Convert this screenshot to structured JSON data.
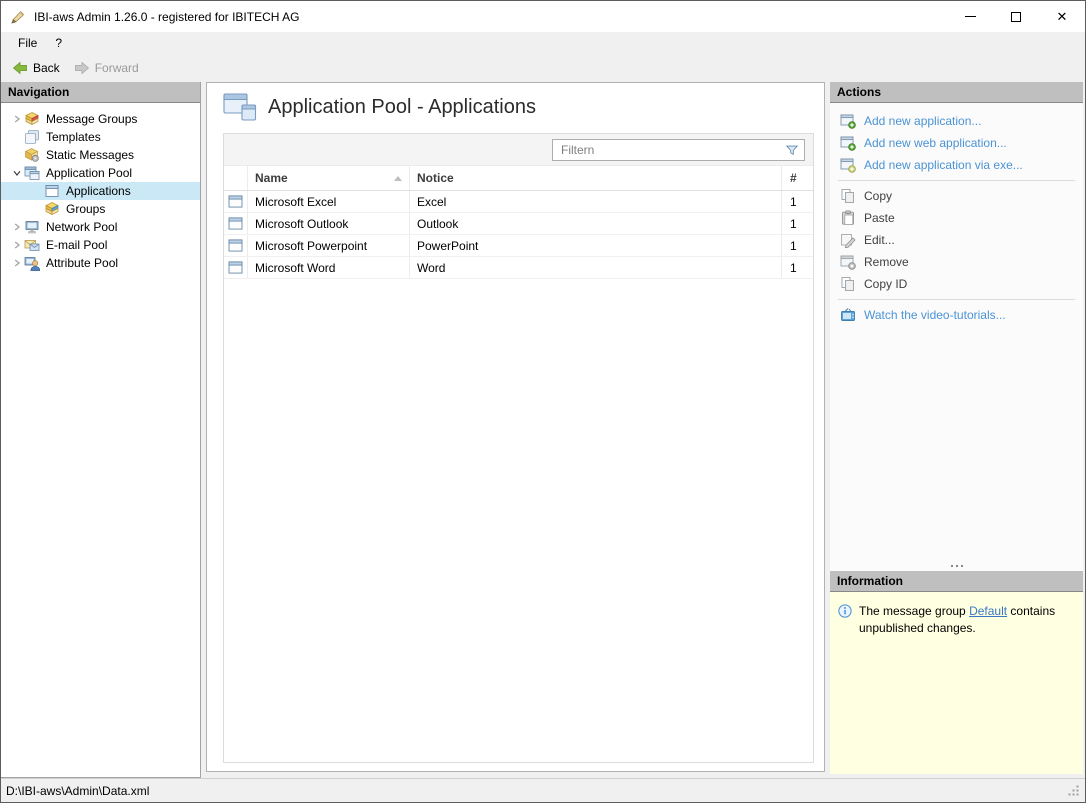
{
  "window": {
    "title": "IBI-aws Admin 1.26.0 - registered for IBITECH AG",
    "controls": {
      "close": "✕"
    }
  },
  "menu": {
    "items": [
      {
        "label": "File"
      },
      {
        "label": "?"
      }
    ]
  },
  "toolbar": {
    "back_label": "Back",
    "forward_label": "Forward"
  },
  "navigation": {
    "header": "Navigation",
    "items": [
      {
        "label": "Message Groups",
        "icon": "message-groups-icon",
        "expander": "collapsed",
        "level": 0,
        "selected": false
      },
      {
        "label": "Templates",
        "icon": "templates-icon",
        "expander": "none",
        "level": 0,
        "selected": false
      },
      {
        "label": "Static Messages",
        "icon": "static-messages-icon",
        "expander": "none",
        "level": 0,
        "selected": false
      },
      {
        "label": "Application Pool",
        "icon": "application-pool-icon",
        "expander": "expanded",
        "level": 0,
        "selected": false
      },
      {
        "label": "Applications",
        "icon": "applications-icon",
        "expander": "none",
        "level": 1,
        "selected": true
      },
      {
        "label": "Groups",
        "icon": "groups-icon",
        "expander": "none",
        "level": 1,
        "selected": false
      },
      {
        "label": "Network Pool",
        "icon": "network-pool-icon",
        "expander": "collapsed",
        "level": 0,
        "selected": false
      },
      {
        "label": "E-mail Pool",
        "icon": "email-pool-icon",
        "expander": "collapsed",
        "level": 0,
        "selected": false
      },
      {
        "label": "Attribute Pool",
        "icon": "attribute-pool-icon",
        "expander": "collapsed",
        "level": 0,
        "selected": false
      }
    ]
  },
  "main": {
    "title": "Application Pool - Applications",
    "filter": {
      "placeholder": "Filtern"
    },
    "table": {
      "columns": [
        "Name",
        "Notice",
        "#"
      ],
      "sort": {
        "column": "Name",
        "direction": "ascending"
      },
      "rows": [
        {
          "name": "Microsoft Excel",
          "notice": "Excel",
          "count": "1"
        },
        {
          "name": "Microsoft Outlook",
          "notice": "Outlook",
          "count": "1"
        },
        {
          "name": "Microsoft Powerpoint",
          "notice": "PowerPoint",
          "count": "1"
        },
        {
          "name": "Microsoft Word",
          "notice": "Word",
          "count": "1"
        }
      ]
    }
  },
  "actions": {
    "header": "Actions",
    "items": [
      {
        "label": "Add new application...",
        "enabled": true
      },
      {
        "label": "Add new web application...",
        "enabled": true
      },
      {
        "label": "Add new application via exe...",
        "enabled": true
      },
      {
        "label": "Copy",
        "enabled": false
      },
      {
        "label": "Paste",
        "enabled": false
      },
      {
        "label": "Edit...",
        "enabled": false
      },
      {
        "label": "Remove",
        "enabled": false
      },
      {
        "label": "Copy ID",
        "enabled": false
      },
      {
        "label": "Watch the video-tutorials...",
        "enabled": true
      }
    ]
  },
  "information": {
    "header": "Information",
    "text_before": "The message group ",
    "link_label": "Default",
    "text_after": " contains unpublished changes."
  },
  "statusbar": {
    "path": "D:\\IBI-aws\\Admin\\Data.xml"
  },
  "colors": {
    "selection": "#cbe8f7",
    "link_blue": "#4b93d4",
    "info_background": "#ffffe1",
    "panel_header": "#bfbfbf",
    "back_arrow_green": "#86b93c"
  }
}
